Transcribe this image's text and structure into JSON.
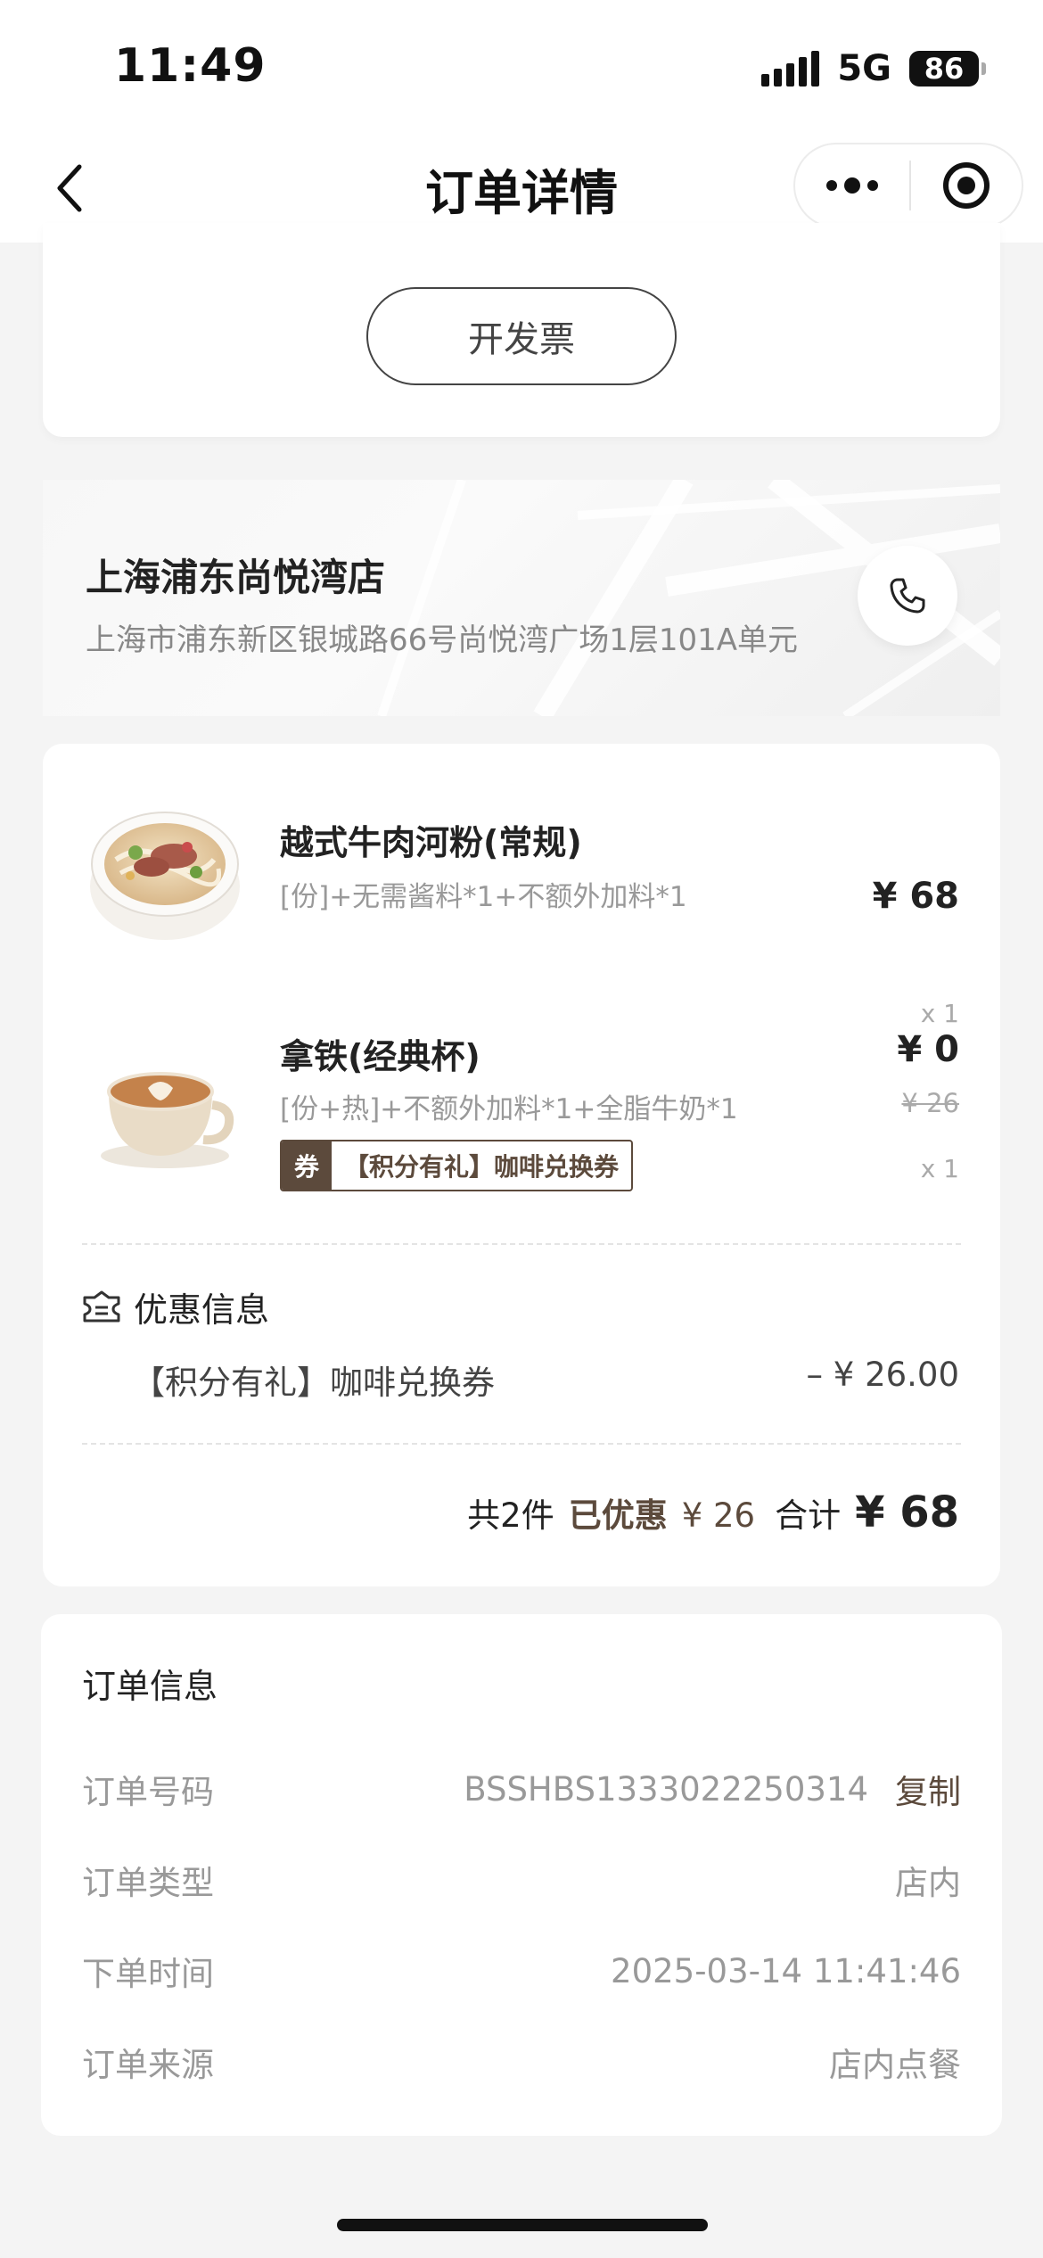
{
  "status_bar": {
    "time": "11:49",
    "network": "5G",
    "battery": "86"
  },
  "nav": {
    "title": "订单详情"
  },
  "invoice": {
    "button_label": "开发票"
  },
  "store": {
    "name": "上海浦东尚悦湾店",
    "address": "上海市浦东新区银城路66号尚悦湾广场1层101A单元"
  },
  "order_items": [
    {
      "name": "越式牛肉河粉(常规)",
      "spec": "[份]+无需酱料*1+不额外加料*1",
      "price": "¥ 68",
      "quantity": "x 1"
    },
    {
      "name": "拿铁(经典杯)",
      "spec": "[份+热]+不额外加料*1+全脂牛奶*1",
      "price": "¥ 0",
      "original_price": "¥ 26",
      "quantity": "x 1",
      "coupon_icon": "券",
      "coupon_label": "【积分有礼】咖啡兑换券"
    }
  ],
  "discount": {
    "title": "优惠信息",
    "items": [
      {
        "name": "【积分有礼】咖啡兑换券",
        "amount": "– ¥ 26.00"
      }
    ]
  },
  "summary": {
    "count": "共2件",
    "saved_label": "已优惠",
    "saved_value": "¥ 26",
    "total_label": "合计",
    "total_value": "¥ 68"
  },
  "order_info": {
    "title": "订单信息",
    "rows": [
      {
        "label": "订单号码",
        "value": "BSSHBS1333022250314",
        "action": "复制"
      },
      {
        "label": "订单类型",
        "value": "店内"
      },
      {
        "label": "下单时间",
        "value": "2025-03-14 11:41:46"
      },
      {
        "label": "订单来源",
        "value": "店内点餐"
      }
    ]
  },
  "colors": {
    "accent": "#5c4a3c",
    "background": "#f4f4f4",
    "muted_text": "#999999"
  }
}
